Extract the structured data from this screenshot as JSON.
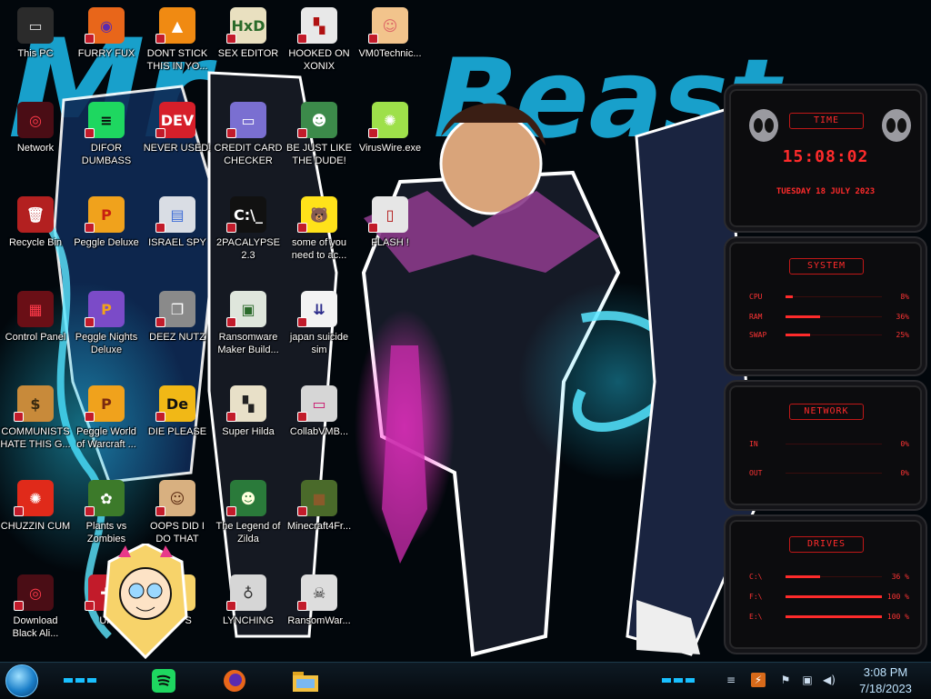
{
  "desktop": {
    "icons": [
      {
        "label": "This PC",
        "glyph": "▭",
        "bg": "#2b2b2b",
        "fg": "#ddd"
      },
      {
        "label": "FURRY FUX",
        "glyph": "◉",
        "bg": "#e8661a",
        "fg": "#5a2bb0"
      },
      {
        "label": "DONT STICK THIS IN YO...",
        "glyph": "▲",
        "bg": "#f08a12",
        "fg": "#fff"
      },
      {
        "label": "SEX EDITOR",
        "glyph": "HxD",
        "bg": "#e9e0c0",
        "fg": "#2a6a2a"
      },
      {
        "label": "HOOKED ON XONIX",
        "glyph": "▚",
        "bg": "#e8e8e8",
        "fg": "#b01010"
      },
      {
        "label": "VM0Technic...",
        "glyph": "☺",
        "bg": "#f2c48c",
        "fg": "#d66"
      },
      {
        "label": "Network",
        "glyph": "◎",
        "bg": "#4a0d15",
        "fg": "#ff3b4a"
      },
      {
        "label": "DIFOR DUMBASS",
        "glyph": "≡",
        "bg": "#1ed760",
        "fg": "#0a0a0a"
      },
      {
        "label": "NEVER USED!",
        "glyph": "DEV",
        "bg": "#d61f2a",
        "fg": "#fff"
      },
      {
        "label": "CREDIT CARD CHECKER",
        "glyph": "▭",
        "bg": "#7a6fd1",
        "fg": "#fff"
      },
      {
        "label": "BE JUST LIKE THE DUDE!",
        "glyph": "☻",
        "bg": "#3c8a4a",
        "fg": "#fff"
      },
      {
        "label": "VirusWire.exe",
        "glyph": "✺",
        "bg": "#9ee04a",
        "fg": "#fff"
      },
      {
        "label": "Recycle Bin",
        "glyph": "🗑",
        "bg": "#b32020",
        "fg": "#fff"
      },
      {
        "label": "Peggle Deluxe",
        "glyph": "P",
        "bg": "#f0a21c",
        "fg": "#c82010"
      },
      {
        "label": "ISRAEL SPY",
        "glyph": "▤",
        "bg": "#d9dde4",
        "fg": "#3a6ad6"
      },
      {
        "label": "2PACALYPSE 2.3",
        "glyph": "C:\\_",
        "bg": "#111",
        "fg": "#fff"
      },
      {
        "label": "some of you need to ac...",
        "glyph": "🐻",
        "bg": "#ffe21a",
        "fg": "#7a3b10"
      },
      {
        "label": "FLASH !",
        "glyph": "▯",
        "bg": "#e6e6e6",
        "fg": "#b01010"
      },
      {
        "label": "Control Panel",
        "glyph": "▦",
        "bg": "#6a0f16",
        "fg": "#ff3b4a"
      },
      {
        "label": "Peggle Nights Deluxe",
        "glyph": "P",
        "bg": "#7b4bc8",
        "fg": "#f0a21c"
      },
      {
        "label": "DEEZ NUTZ",
        "glyph": "❐",
        "bg": "#8a8a8a",
        "fg": "#fff"
      },
      {
        "label": "Ransomware Maker Build...",
        "glyph": "▣",
        "bg": "#dfe6dc",
        "fg": "#2a6a2a"
      },
      {
        "label": "japan suicide sim",
        "glyph": "⇊",
        "bg": "#f3f3f3",
        "fg": "#2a2a8a"
      },
      {
        "label": "COMMUNISTS HATE THIS G...",
        "glyph": "$",
        "bg": "#c88a3a",
        "fg": "#3a2a10"
      },
      {
        "label": "Peggle World of Warcraft ...",
        "glyph": "P",
        "bg": "#f0a21c",
        "fg": "#7a2a10"
      },
      {
        "label": "DIE PLEASE",
        "glyph": "De",
        "bg": "#f1b816",
        "fg": "#111"
      },
      {
        "label": "Super Hilda",
        "glyph": "▚",
        "bg": "#e8e0c8",
        "fg": "#222"
      },
      {
        "label": "CollabVMB...",
        "glyph": "▭",
        "bg": "#d6d6d6",
        "fg": "#c8106a"
      },
      {
        "label": "CHUZZIN CUM",
        "glyph": "✺",
        "bg": "#e02a1a",
        "fg": "#fff"
      },
      {
        "label": "Plants vs Zombies",
        "glyph": "✿",
        "bg": "#3c7a2a",
        "fg": "#fff"
      },
      {
        "label": "OOPS DID I DO THAT",
        "glyph": "☺",
        "bg": "#d8b080",
        "fg": "#5a2a10"
      },
      {
        "label": "The Legend of Zilda",
        "glyph": "☻",
        "bg": "#2a7a3a",
        "fg": "#ffd"
      },
      {
        "label": "Minecraft4Fr...",
        "glyph": "■",
        "bg": "#4a6a2a",
        "fg": "#8a5a2a"
      },
      {
        "label": "Download Black Ali...",
        "glyph": "◎",
        "bg": "#4a0d15",
        "fg": "#ff3b4a"
      },
      {
        "label": "UK",
        "glyph": "✚",
        "bg": "#c21b2a",
        "fg": "#fff"
      },
      {
        "label": "OOPS",
        "glyph": "☺",
        "bg": "#f7d36a",
        "fg": "#5a2a10"
      },
      {
        "label": "LYNCHING",
        "glyph": "♁",
        "bg": "#d6d6d6",
        "fg": "#333"
      },
      {
        "label": "RansomWar...",
        "glyph": "☠",
        "bg": "#ddd",
        "fg": "#222"
      }
    ]
  },
  "wallpaper": {
    "title_text": "MrBeast",
    "accent": "#18b8e0"
  },
  "gadgets": {
    "time": {
      "title": "TIME",
      "time": "15:08:02",
      "date": "TUESDAY 18 JULY 2023"
    },
    "system": {
      "title": "SYSTEM",
      "rows": [
        {
          "label": "CPU",
          "value": "8%",
          "level": 0.08
        },
        {
          "label": "RAM",
          "value": "36%",
          "level": 0.36
        },
        {
          "label": "SWAP",
          "value": "25%",
          "level": 0.25
        }
      ]
    },
    "network": {
      "title": "NETWORK",
      "rows": [
        {
          "label": "IN",
          "value": "0%"
        },
        {
          "label": "OUT",
          "value": "0%"
        }
      ]
    },
    "drives": {
      "title": "DRIVES",
      "rows": [
        {
          "label": "C:\\",
          "value": "36 %",
          "level": 0.36
        },
        {
          "label": "F:\\",
          "value": "100 %",
          "level": 1.0
        },
        {
          "label": "E:\\",
          "value": "100 %",
          "level": 1.0
        }
      ]
    }
  },
  "taskbar": {
    "pinned": [
      {
        "name": "spotify",
        "color": "#1ed760"
      },
      {
        "name": "firefox",
        "color": "#e8661a"
      },
      {
        "name": "file-explorer",
        "color": "#f3c040"
      }
    ],
    "tray": {
      "time": "3:08 PM",
      "date": "7/18/2023"
    }
  }
}
